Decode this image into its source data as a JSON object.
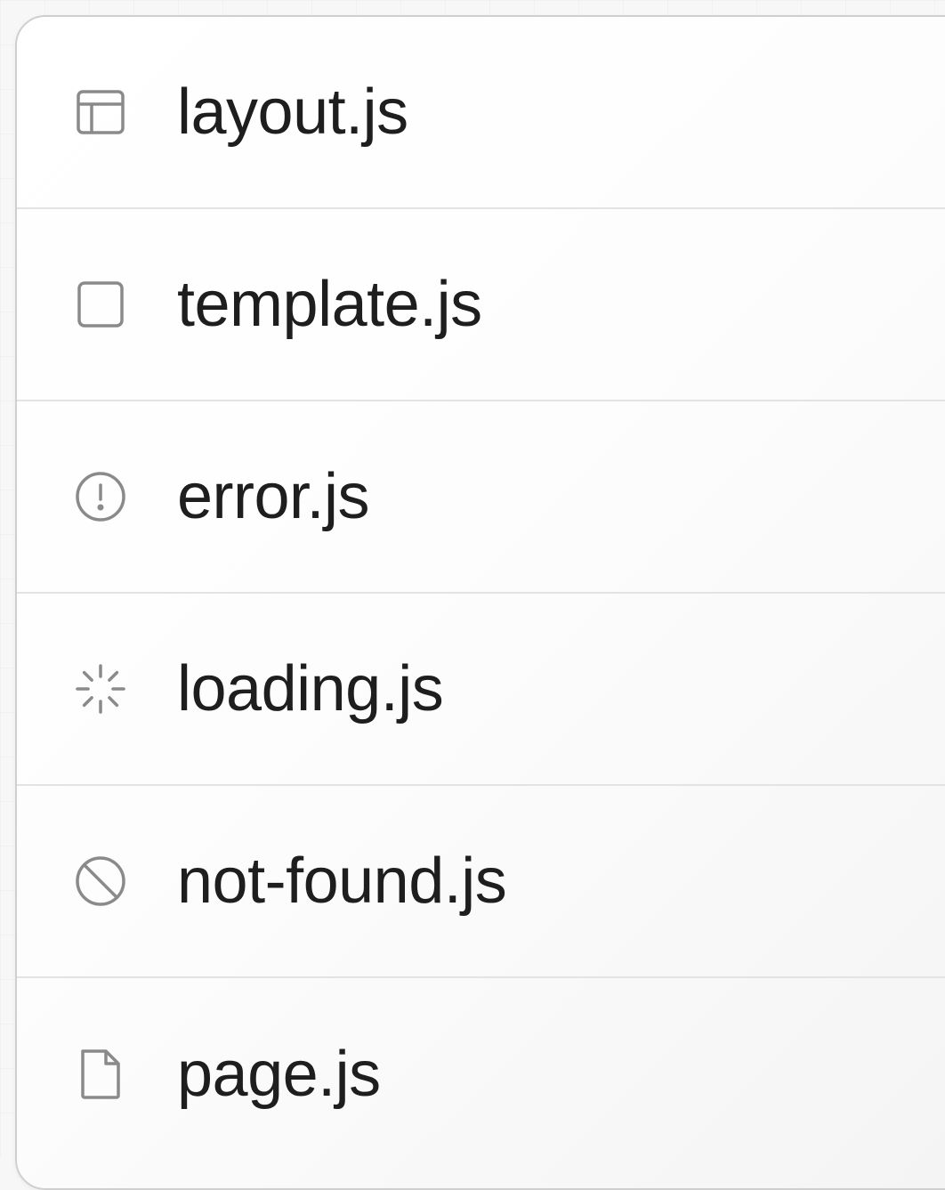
{
  "files": [
    {
      "name": "layout.js",
      "icon": "layout-icon"
    },
    {
      "name": "template.js",
      "icon": "square-icon"
    },
    {
      "name": "error.js",
      "icon": "alert-circle-icon"
    },
    {
      "name": "loading.js",
      "icon": "loader-icon"
    },
    {
      "name": "not-found.js",
      "icon": "ban-icon"
    },
    {
      "name": "page.js",
      "icon": "file-icon"
    }
  ],
  "colors": {
    "text": "#1e1e1e",
    "icon": "#8a8a8a",
    "border": "#cfcfcf",
    "divider": "#e3e3e3"
  }
}
